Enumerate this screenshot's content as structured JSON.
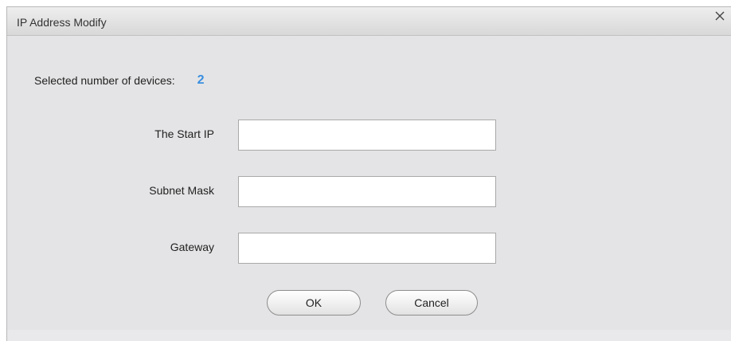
{
  "dialog": {
    "title": "IP Address Modify",
    "close_icon": "close-icon"
  },
  "devices": {
    "label": "Selected number of devices:",
    "count": "2",
    "count_color": "#3a8fe0"
  },
  "fields": {
    "start_ip": {
      "label": "The Start IP",
      "value": ""
    },
    "subnet_mask": {
      "label": "Subnet Mask",
      "value": ""
    },
    "gateway": {
      "label": "Gateway",
      "value": ""
    }
  },
  "buttons": {
    "ok": "OK",
    "cancel": "Cancel"
  }
}
